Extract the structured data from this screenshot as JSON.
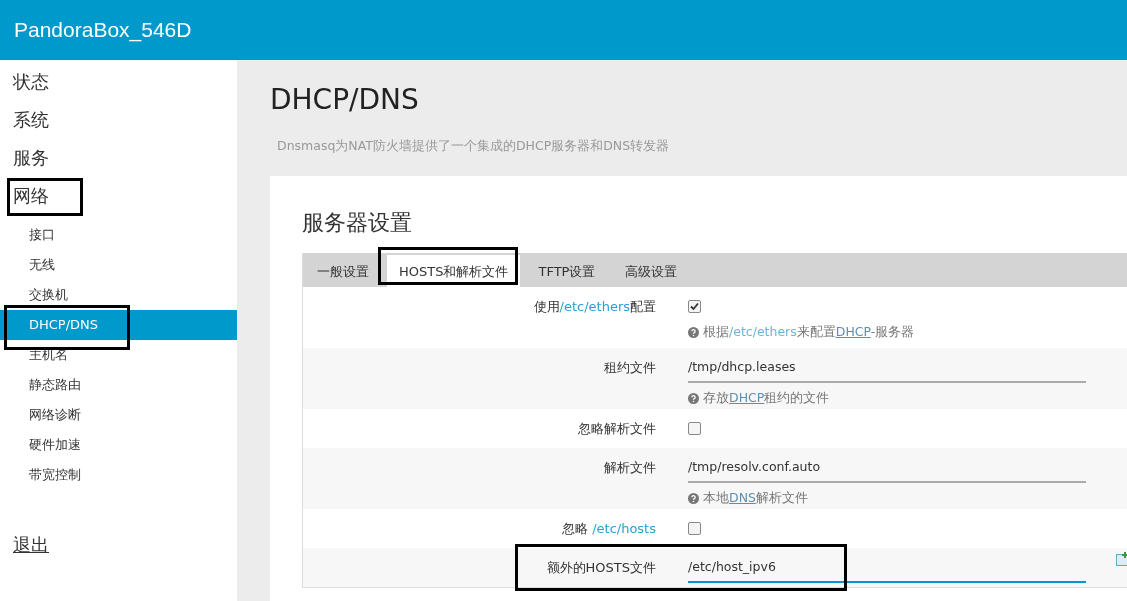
{
  "header": {
    "title": "PandoraBox_546D"
  },
  "sidebar": {
    "items": [
      {
        "label": "状态",
        "selected": false
      },
      {
        "label": "系统",
        "selected": false
      },
      {
        "label": "服务",
        "selected": false
      },
      {
        "label": "网络",
        "selected": false,
        "children": [
          {
            "label": "接口",
            "selected": false
          },
          {
            "label": "无线",
            "selected": false
          },
          {
            "label": "交换机",
            "selected": false
          },
          {
            "label": "DHCP/DNS",
            "selected": true
          },
          {
            "label": "主机名",
            "selected": false
          },
          {
            "label": "静态路由",
            "selected": false
          },
          {
            "label": "网络诊断",
            "selected": false
          },
          {
            "label": "硬件加速",
            "selected": false
          },
          {
            "label": "带宽控制",
            "selected": false
          }
        ]
      }
    ],
    "logout": "退出"
  },
  "page": {
    "title": "DHCP/DNS",
    "description": "Dnsmasq为NAT防火墙提供了一个集成的DHCP服务器和DNS转发器"
  },
  "section": {
    "title": "服务器设置",
    "tabs": [
      {
        "label": "一般设置",
        "selected": false
      },
      {
        "label": "HOSTS和解析文件",
        "selected": true
      },
      {
        "label": "TFTP设置",
        "selected": false
      },
      {
        "label": "高级设置",
        "selected": false
      }
    ],
    "rows": [
      {
        "kind": "checkbox",
        "label": [
          {
            "kind": "text",
            "text": "使用"
          },
          {
            "kind": "path",
            "text": "/etc/ethers"
          },
          {
            "kind": "text",
            "text": "配置"
          }
        ],
        "checked": true,
        "hint": [
          {
            "kind": "text",
            "text": "根据"
          },
          {
            "kind": "path",
            "text": "/etc/ethers"
          },
          {
            "kind": "text",
            "text": "来配置"
          },
          {
            "kind": "link",
            "text": "DHCP"
          },
          {
            "kind": "text",
            "text": "-服务器"
          }
        ]
      },
      {
        "kind": "text",
        "label": [
          {
            "kind": "text",
            "text": "租约文件"
          }
        ],
        "value": "/tmp/dhcp.leases",
        "focused": false,
        "hint": [
          {
            "kind": "text",
            "text": "存放"
          },
          {
            "kind": "link",
            "text": "DHCP"
          },
          {
            "kind": "text",
            "text": "租约的文件"
          }
        ]
      },
      {
        "kind": "checkbox",
        "label": [
          {
            "kind": "text",
            "text": "忽略解析文件"
          }
        ],
        "checked": false
      },
      {
        "kind": "text",
        "label": [
          {
            "kind": "text",
            "text": "解析文件"
          }
        ],
        "value": "/tmp/resolv.conf.auto",
        "focused": false,
        "hint": [
          {
            "kind": "text",
            "text": "本地"
          },
          {
            "kind": "link",
            "text": "DNS"
          },
          {
            "kind": "text",
            "text": "解析文件"
          }
        ]
      },
      {
        "kind": "checkbox",
        "label": [
          {
            "kind": "text",
            "text": "忽略 "
          },
          {
            "kind": "path",
            "text": "/etc/hosts"
          }
        ],
        "checked": false
      },
      {
        "kind": "text",
        "label": [
          {
            "kind": "text",
            "text": "额外的HOSTS文件"
          }
        ],
        "value": "/etc/host_ipv6",
        "focused": true,
        "add_button": true
      }
    ]
  }
}
